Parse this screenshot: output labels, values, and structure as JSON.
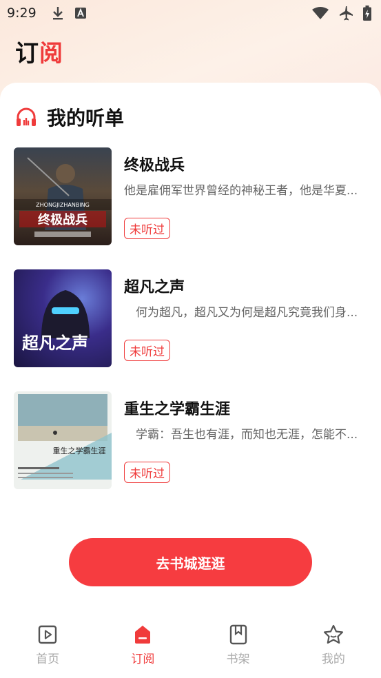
{
  "status_bar": {
    "time": "9:29",
    "icons": [
      "download-icon",
      "a-icon",
      "wifi-icon",
      "airplane-icon",
      "battery-icon"
    ]
  },
  "header": {
    "title_part1": "订",
    "title_part2": "阅"
  },
  "section": {
    "title": "我的听单",
    "icon": "headphones-icon"
  },
  "books": [
    {
      "title": "终极战兵",
      "description": "他是雇佣军世界曾经的神秘王者，他是华夏...",
      "status": "未听过",
      "cover_text": "终极战兵",
      "cover_subtext": "ZHONGJIZHANBING"
    },
    {
      "title": "超凡之声",
      "description": "　何为超凡，超凡又为何是超凡究竟我们身...",
      "status": "未听过",
      "cover_text": "超凡之声"
    },
    {
      "title": "重生之学霸生涯",
      "description": "　学霸：吾生也有涯，而知也无涯，怎能不...",
      "status": "未听过",
      "cover_text": "重生之学霸生涯"
    }
  ],
  "cta": {
    "label": "去书城逛逛"
  },
  "tabs": [
    {
      "label": "首页",
      "icon": "play-icon",
      "active": false
    },
    {
      "label": "订阅",
      "icon": "subscribe-icon",
      "active": true
    },
    {
      "label": "书架",
      "icon": "bookmark-icon",
      "active": false
    },
    {
      "label": "我的",
      "icon": "star-icon",
      "active": false
    }
  ],
  "colors": {
    "accent": "#f63c40",
    "inactive": "#aaaaaa"
  }
}
